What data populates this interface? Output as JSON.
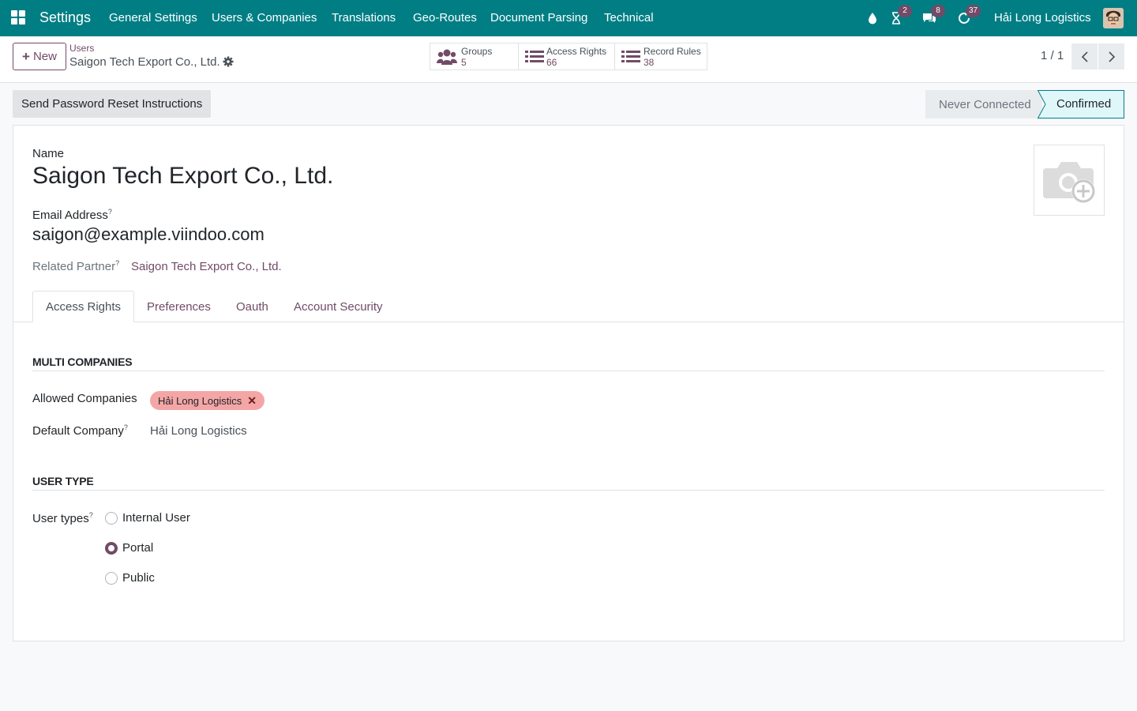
{
  "navbar": {
    "app_name": "Settings",
    "menus": [
      "General Settings",
      "Users & Companies",
      "Translations",
      "Geo-Routes",
      "Document Parsing",
      "Technical"
    ],
    "activity_badge": "2",
    "messages_badge": "8",
    "updates_badge": "37",
    "company": "Hải Long Logistics"
  },
  "control": {
    "new_label": "New",
    "breadcrumb_parent": "Users",
    "breadcrumb_current": "Saigon Tech Export Co., Ltd.",
    "smart_buttons": [
      {
        "label": "Groups",
        "count": "5"
      },
      {
        "label": "Access Rights",
        "count": "66"
      },
      {
        "label": "Record Rules",
        "count": "38"
      }
    ],
    "pager": "1 / 1"
  },
  "statusbar": {
    "reset_button": "Send Password Reset Instructions",
    "stages": [
      "Never Connected",
      "Confirmed"
    ],
    "active_stage": "Confirmed"
  },
  "form": {
    "name_label": "Name",
    "name_value": "Saigon Tech Export Co., Ltd.",
    "email_label": "Email Address",
    "email_value": "saigon@example.viindoo.com",
    "partner_label": "Related Partner",
    "partner_value": "Saigon Tech Export Co., Ltd.",
    "help_mark": "?",
    "tabs": [
      "Access Rights",
      "Preferences",
      "Oauth",
      "Account Security"
    ],
    "active_tab": "Access Rights",
    "multi_companies_title": "Multi Companies",
    "allowed_companies_label": "Allowed Companies",
    "allowed_companies": [
      "Hải Long Logistics"
    ],
    "default_company_label": "Default Company",
    "default_company_value": "Hải Long Logistics",
    "user_type_title": "User Type",
    "user_types_label": "User types",
    "user_type_options": [
      "Internal User",
      "Portal",
      "Public"
    ],
    "user_type_selected": "Portal"
  },
  "colors": {
    "navbar": "#017e84",
    "primary": "#714b67",
    "tag": "#f4a6a6",
    "stage_active": "#e0f7fa"
  }
}
